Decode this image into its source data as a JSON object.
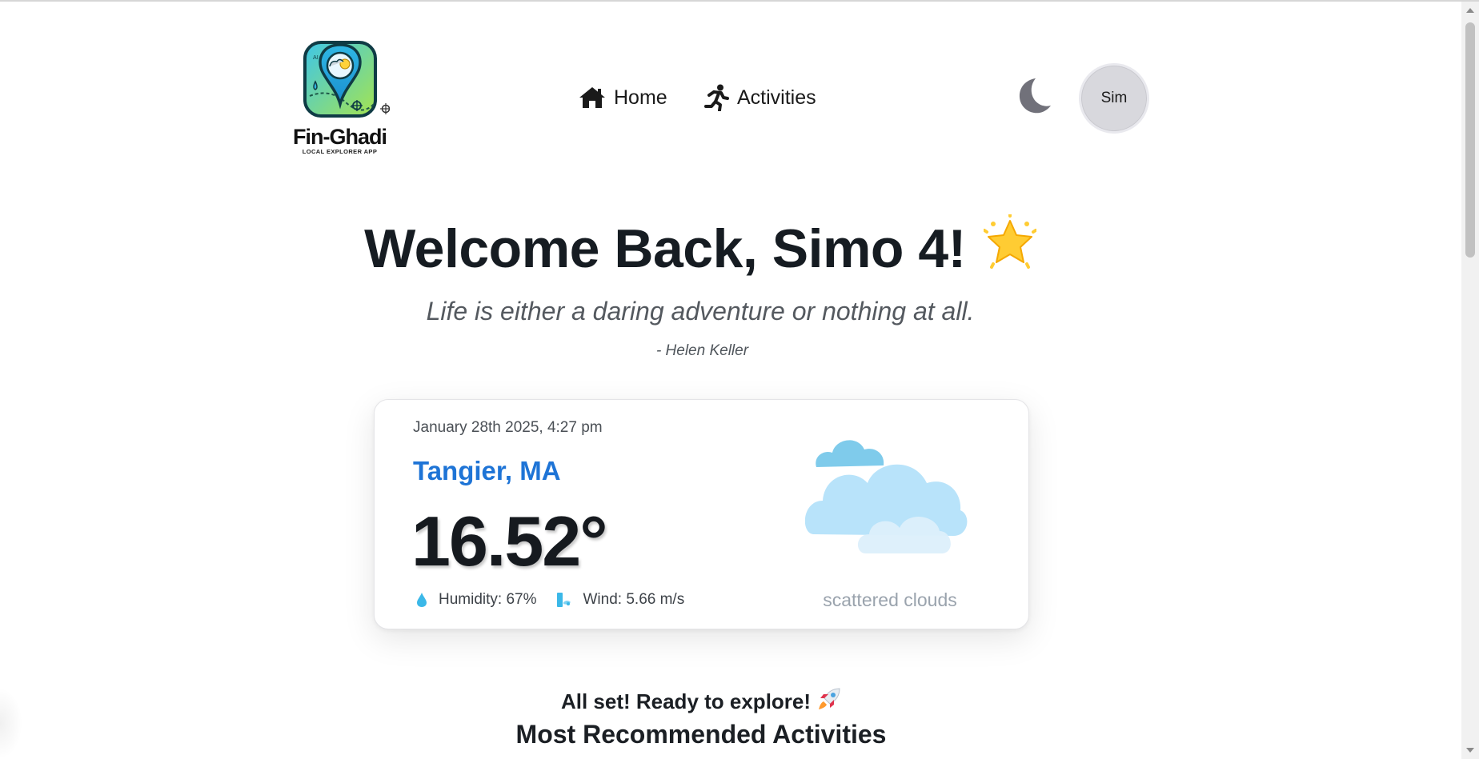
{
  "brand": {
    "name": "Fin-Ghadi",
    "tagline": "LOCAL EXPLORER APP"
  },
  "nav": {
    "home_label": "Home",
    "activities_label": "Activities"
  },
  "user": {
    "avatar_text": "Sim"
  },
  "hero": {
    "welcome": "Welcome Back, Simo 4!",
    "quote": "Life is either a daring adventure or nothing at all.",
    "author": "- Helen Keller"
  },
  "weather": {
    "datetime": "January 28th 2025, 4:27 pm",
    "location": "Tangier, MA",
    "temperature": "16.52°",
    "humidity": "Humidity: 67%",
    "wind": "Wind: 5.66 m/s",
    "description": "scattered clouds",
    "icon": "scattered-clouds-icon"
  },
  "section": {
    "status": "All set! Ready to explore!",
    "heading": "Most Recommended Activities"
  },
  "colors": {
    "accent": "#1e74d6",
    "muted": "#9aa3ad"
  }
}
